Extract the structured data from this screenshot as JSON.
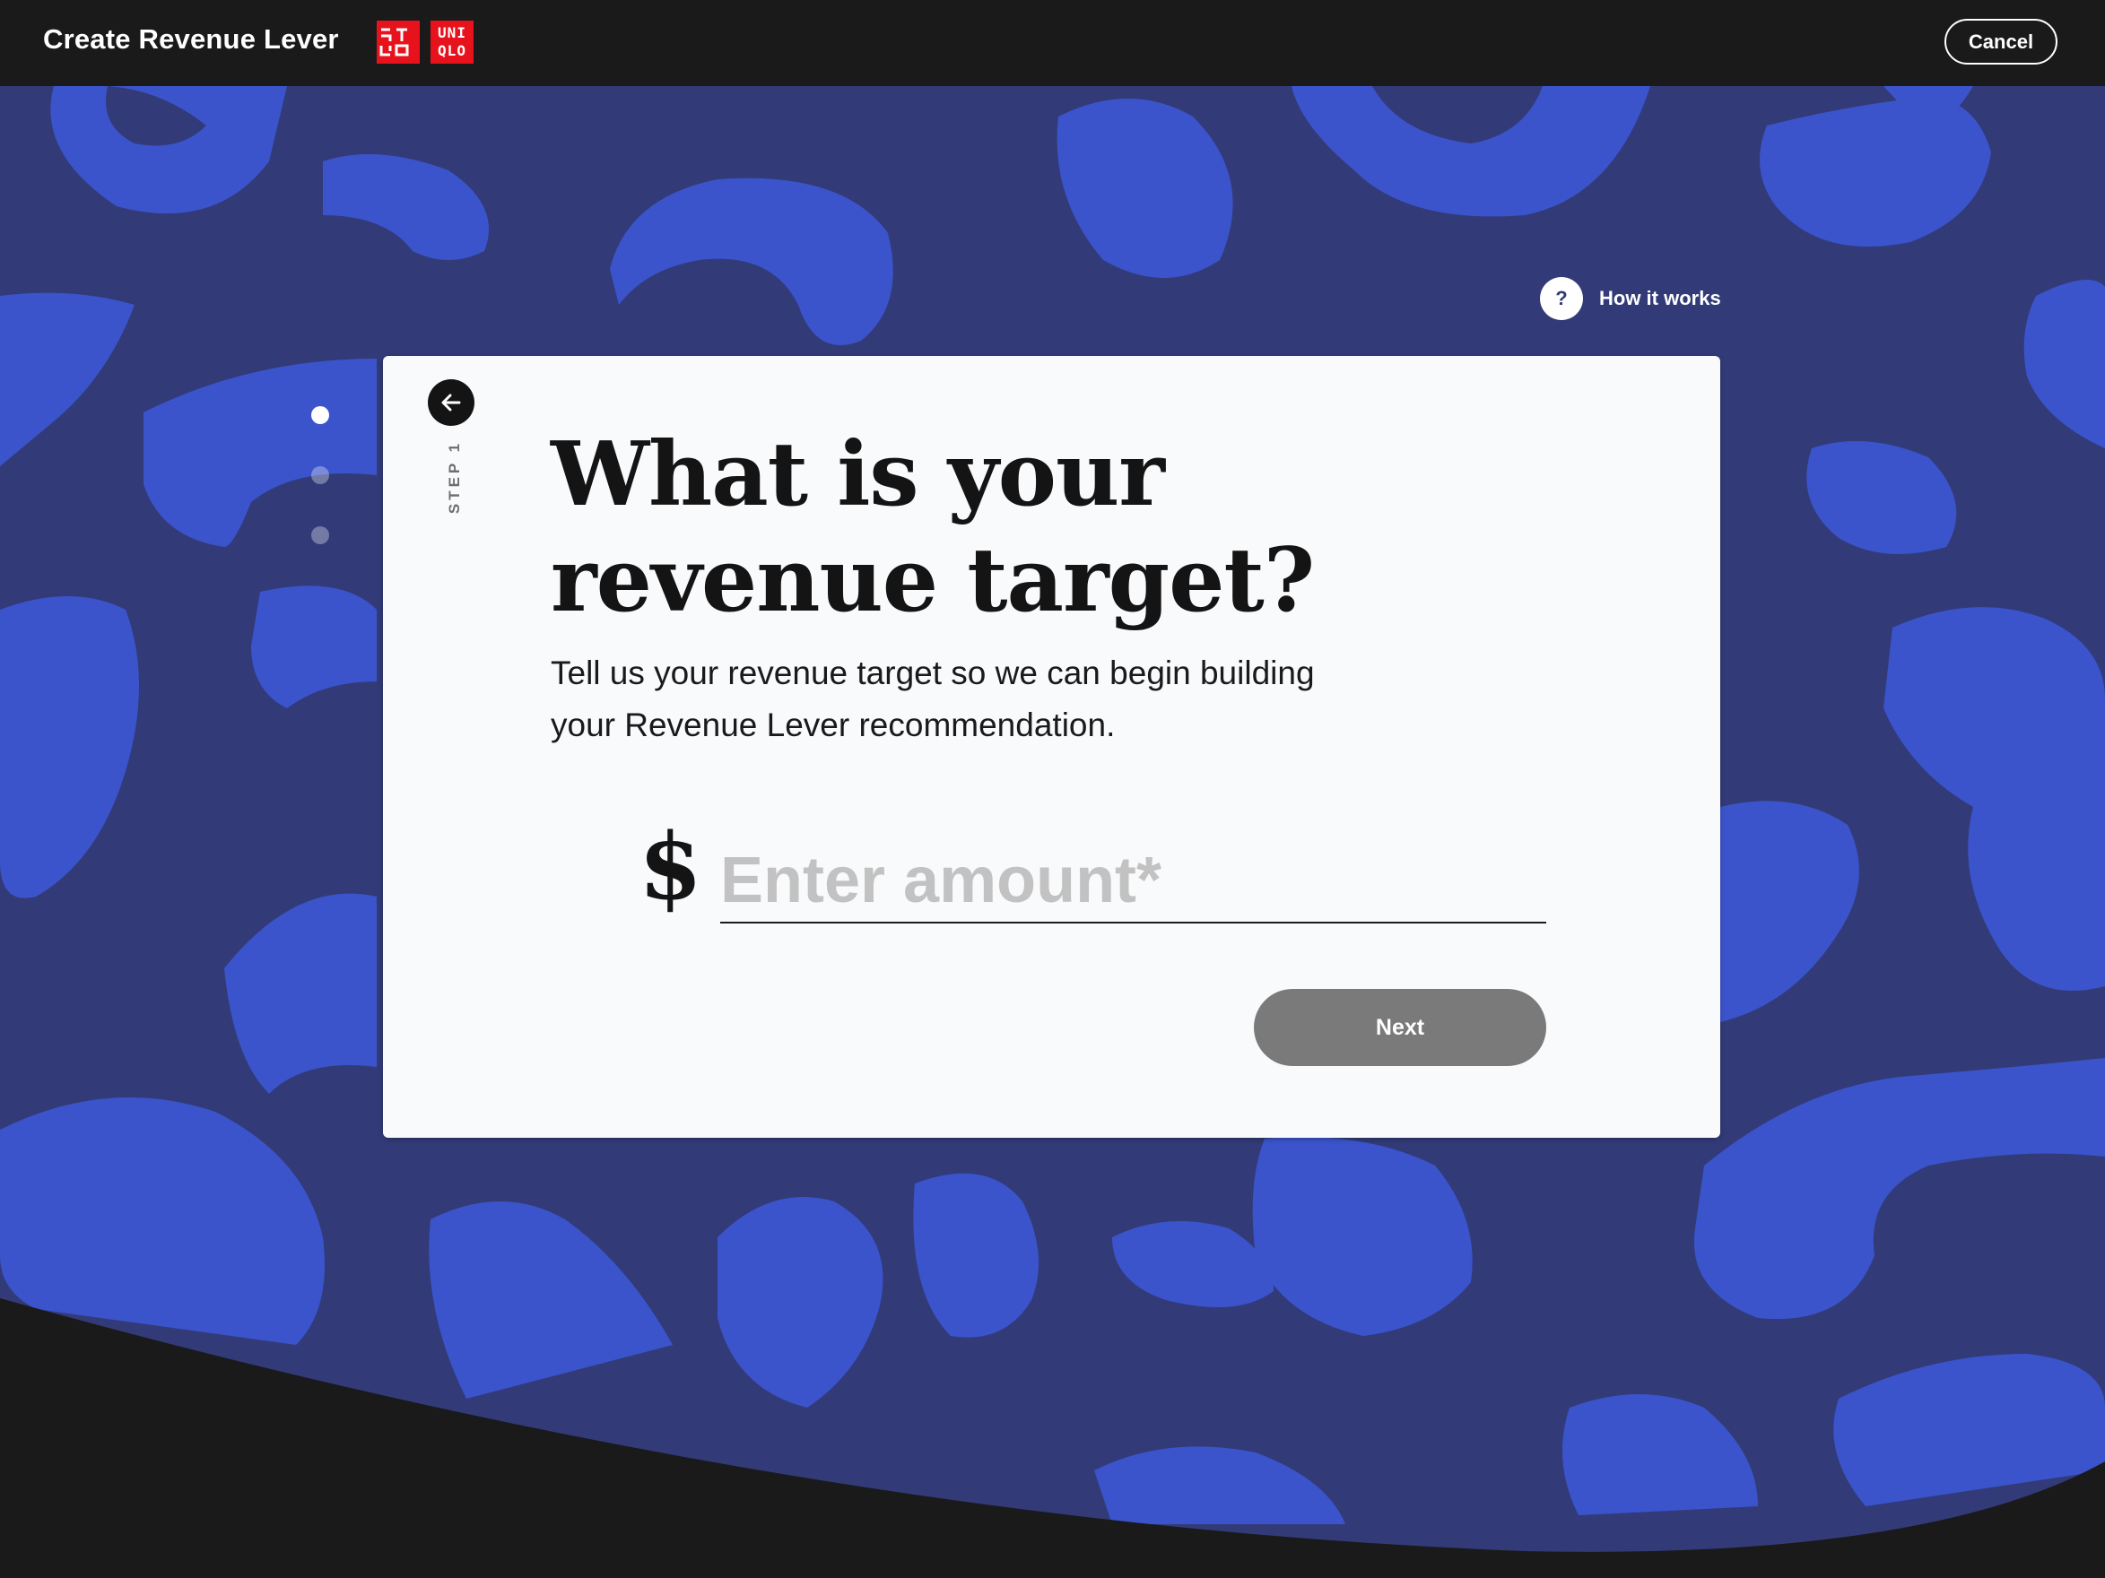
{
  "header": {
    "title": "Create Revenue Lever",
    "logo_line1": "UNI",
    "logo_line2": "QLO",
    "cancel_label": "Cancel"
  },
  "help": {
    "icon": "?",
    "label": "How it works"
  },
  "steps": {
    "total": 3,
    "current": 1
  },
  "card": {
    "step_label": "STEP 1",
    "headline_line1": "What is your",
    "headline_line2": "revenue target?",
    "subtext_line1": "Tell us your revenue target so we can begin building",
    "subtext_line2": "your Revenue Lever recommendation.",
    "currency_symbol": "$",
    "amount_placeholder": "Enter amount*",
    "amount_value": "",
    "next_label": "Next"
  },
  "colors": {
    "background": "#323b78",
    "pattern": "#3b54cc",
    "topbar": "#1a1a1a",
    "brand_red": "#e8121c",
    "next_button_disabled": "#7a7a7a"
  }
}
